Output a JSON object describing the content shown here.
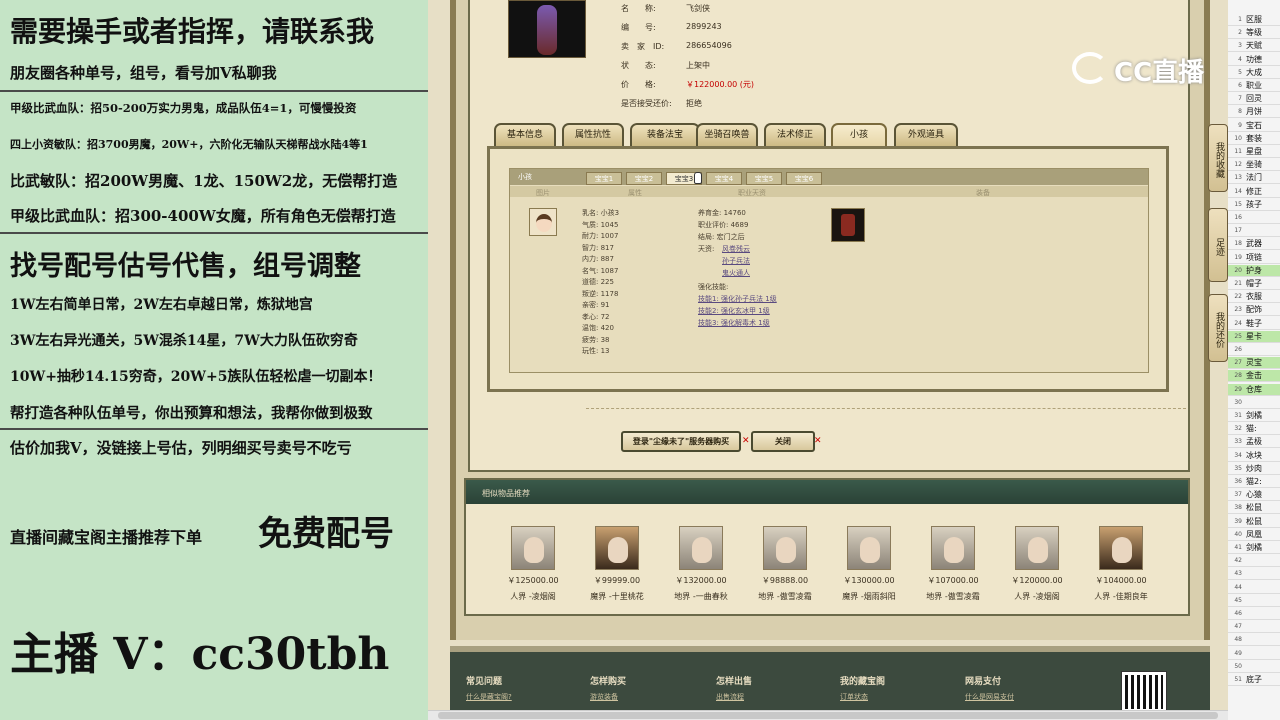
{
  "left_panel": {
    "lines": [
      "需要操手或者指挥，请联系我",
      "朋友圈各种单号，组号，看号加V私聊我",
      "甲级比武血队：招50-200万实力男鬼，成品队伍4=1，可慢慢投资",
      "四上小资敏队：招3700男魔，20W+，六阶化无输队天梯帮战水陆4等1",
      "比武敏队：招200W男魔、1龙、150W2龙，无偿帮打造",
      "甲级比武血队：招300-400W女魔，所有角色无偿帮打造",
      "找号配号估号代售，组号调整",
      "1W左右简单日常，2W左右卓越日常，炼狱地宫",
      "3W左右异光通关，5W混杀14星，7W大力队伍砍穷奇",
      "10W+抽秒14.15穷奇，20W+5族队伍轻松虐一切副本！",
      "帮打造各种队伍单号，你出预算和想法，我帮你做到极致",
      "估价加我V，没链接上号估，列明细买号卖号不吃亏",
      "直播间藏宝阁主播推荐下单",
      "免费配号",
      "主播 V：cc30tbh"
    ]
  },
  "item_info": {
    "rows": [
      {
        "label": "名　　称:",
        "value": "飞剑侠"
      },
      {
        "label": "编　　号:",
        "value": "2899243"
      },
      {
        "label": "卖　家　ID:",
        "value": "286654096"
      },
      {
        "label": "状　　态:",
        "value": "上架中"
      },
      {
        "label": "价　　格:",
        "value": "￥122000.00 (元)"
      },
      {
        "label": "是否接受还价:",
        "value": "拒绝"
      }
    ],
    "price_color": "#c40000"
  },
  "watermark": {
    "text": "CC直播"
  },
  "tabs": [
    "基本信息",
    "属性抗性",
    "装备法宝",
    "坐骑召唤兽",
    "法术修正",
    "小孩",
    "外观道具"
  ],
  "selected_tab": "小孩",
  "child_panel": {
    "title": "小孩",
    "subtabs": [
      "宝宝1",
      "宝宝2",
      "宝宝3",
      "宝宝4",
      "宝宝5",
      "宝宝6"
    ],
    "selected_subtab": "宝宝3",
    "headers": [
      "图片",
      "属性",
      "职业天资",
      "装备"
    ],
    "attrs": [
      {
        "k": "乳名:",
        "v": "小孩3"
      },
      {
        "k": "气质:",
        "v": "1045"
      },
      {
        "k": "耐力:",
        "v": "1007"
      },
      {
        "k": "智力:",
        "v": "817"
      },
      {
        "k": "内力:",
        "v": "887"
      },
      {
        "k": "名气:",
        "v": "1087"
      },
      {
        "k": "道德:",
        "v": "225"
      },
      {
        "k": "叛逆:",
        "v": "1178"
      },
      {
        "k": "亲密:",
        "v": "91"
      },
      {
        "k": "孝心:",
        "v": "72"
      },
      {
        "k": "温饱:",
        "v": "420"
      },
      {
        "k": "疲劳:",
        "v": "38"
      },
      {
        "k": "玩性:",
        "v": "13"
      }
    ],
    "career": {
      "raise": {
        "k": "养育金:",
        "v": "14760"
      },
      "score": {
        "k": "职业评价:",
        "v": "4689"
      },
      "ending": {
        "k": "结局:",
        "v": "宏门之后"
      },
      "talent_label": "天资:",
      "talents": [
        "风卷残云",
        "孙子兵法",
        "鬼火通人"
      ],
      "skills_label": "强化技能:",
      "skills": [
        "技能1: 强化孙子兵法 1级",
        "技能2: 强化玄冰甲 1级",
        "技能3: 强化解毒术 1级"
      ]
    }
  },
  "buttons": {
    "login": "登录\"尘缘未了\"服务器购买",
    "close": "关闭"
  },
  "related": {
    "title": "相似物品推荐",
    "items": [
      {
        "price": "￥125000.00",
        "server": "人界 -凌烟阁",
        "dark": false
      },
      {
        "price": "￥99999.00",
        "server": "魔界 -十里桃花",
        "dark": true
      },
      {
        "price": "￥132000.00",
        "server": "地界 -一曲春秋",
        "dark": false
      },
      {
        "price": "￥98888.00",
        "server": "地界 -傲雪凌霜",
        "dark": false
      },
      {
        "price": "￥130000.00",
        "server": "魔界 -烟雨斜阳",
        "dark": false
      },
      {
        "price": "￥107000.00",
        "server": "地界 -傲雪凌霜",
        "dark": false
      },
      {
        "price": "￥120000.00",
        "server": "人界 -凌烟阁",
        "dark": false
      },
      {
        "price": "￥104000.00",
        "server": "人界 -佳期良年",
        "dark": true
      }
    ]
  },
  "side_buttons": [
    "我的收藏",
    "足迹",
    "我的还价"
  ],
  "footer": {
    "columns": [
      {
        "title": "常见问题",
        "link": "什么是藏宝阁?"
      },
      {
        "title": "怎样购买",
        "link": "游览装备"
      },
      {
        "title": "怎样出售",
        "link": "出售流程"
      },
      {
        "title": "我的藏宝阁",
        "link": "订单状态"
      },
      {
        "title": "网易支付",
        "link": "什么是网易支付"
      }
    ]
  },
  "sheet": {
    "rows": [
      {
        "n": "1",
        "c": "区服"
      },
      {
        "n": "2",
        "c": "等级"
      },
      {
        "n": "3",
        "c": "天赋"
      },
      {
        "n": "4",
        "c": "功德"
      },
      {
        "n": "5",
        "c": "大成"
      },
      {
        "n": "6",
        "c": "职业"
      },
      {
        "n": "7",
        "c": "回灵"
      },
      {
        "n": "8",
        "c": "月饼"
      },
      {
        "n": "9",
        "c": "宝石"
      },
      {
        "n": "10",
        "c": "套装"
      },
      {
        "n": "11",
        "c": "星盘"
      },
      {
        "n": "12",
        "c": "坐骑"
      },
      {
        "n": "13",
        "c": "法门"
      },
      {
        "n": "14",
        "c": "修正"
      },
      {
        "n": "15",
        "c": "孩子"
      },
      {
        "n": "16",
        "c": ""
      },
      {
        "n": "17",
        "c": ""
      },
      {
        "n": "18",
        "c": "武器"
      },
      {
        "n": "19",
        "c": "项链"
      },
      {
        "n": "20",
        "c": "护身"
      },
      {
        "n": "21",
        "c": "帽子"
      },
      {
        "n": "22",
        "c": "衣服"
      },
      {
        "n": "23",
        "c": "配饰"
      },
      {
        "n": "24",
        "c": "鞋子"
      },
      {
        "n": "25",
        "c": "星卡"
      },
      {
        "n": "26",
        "c": ""
      },
      {
        "n": "27",
        "c": "灵宝"
      },
      {
        "n": "28",
        "c": "金击"
      },
      {
        "n": "29",
        "c": "仓库"
      },
      {
        "n": "30",
        "c": ""
      },
      {
        "n": "31",
        "c": "剑橘"
      },
      {
        "n": "32",
        "c": "猫:"
      },
      {
        "n": "33",
        "c": "孟极"
      },
      {
        "n": "34",
        "c": "冰块"
      },
      {
        "n": "35",
        "c": "炒肉"
      },
      {
        "n": "36",
        "c": "猫2:"
      },
      {
        "n": "37",
        "c": "心猿"
      },
      {
        "n": "38",
        "c": "松鼠"
      },
      {
        "n": "39",
        "c": "松鼠"
      },
      {
        "n": "40",
        "c": "凤凰"
      },
      {
        "n": "41",
        "c": "剑橘"
      },
      {
        "n": "42",
        "c": ""
      },
      {
        "n": "43",
        "c": ""
      },
      {
        "n": "44",
        "c": ""
      },
      {
        "n": "45",
        "c": ""
      },
      {
        "n": "46",
        "c": ""
      },
      {
        "n": "47",
        "c": ""
      },
      {
        "n": "48",
        "c": ""
      },
      {
        "n": "49",
        "c": ""
      },
      {
        "n": "50",
        "c": ""
      },
      {
        "n": "51",
        "c": "底子"
      }
    ],
    "highlight_rows": [
      "20",
      "25",
      "27",
      "28",
      "29"
    ],
    "highlight_color": "#bde7a8"
  }
}
